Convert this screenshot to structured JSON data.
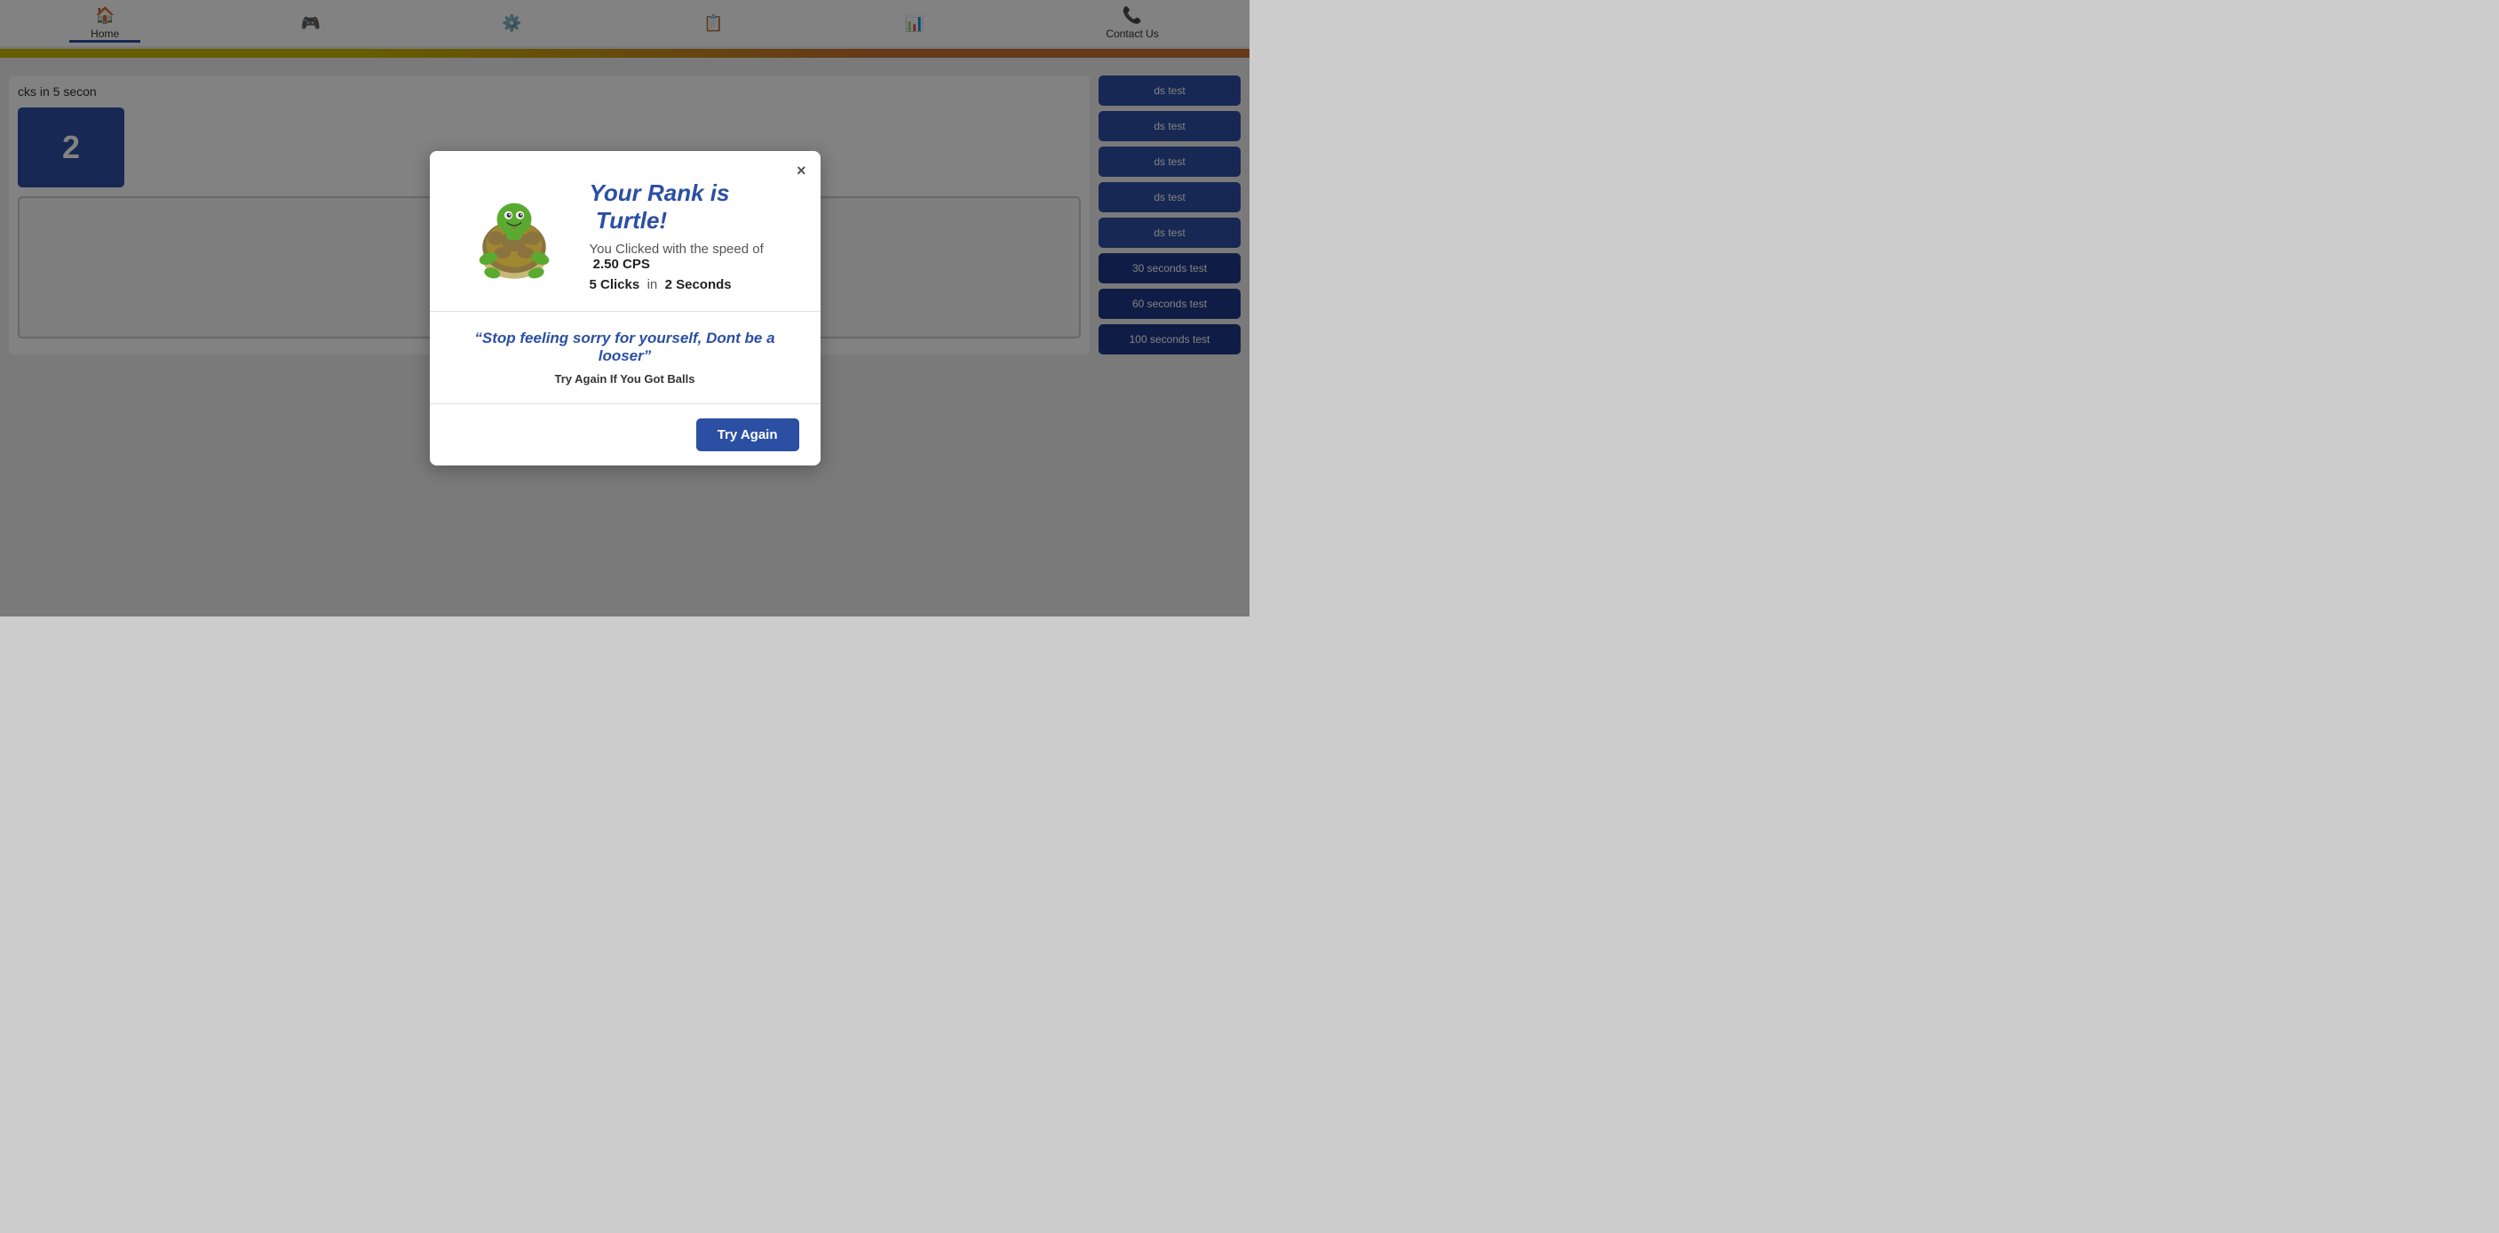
{
  "navbar": {
    "home_label": "Home",
    "contact_label": "Contact Us"
  },
  "background": {
    "truncated_text": "cks in 5 secon",
    "counter": "2",
    "sidebar_buttons": [
      {
        "label": "ds test",
        "style": "normal"
      },
      {
        "label": "ds test",
        "style": "normal"
      },
      {
        "label": "ds test",
        "style": "normal"
      },
      {
        "label": "ds test",
        "style": "normal"
      },
      {
        "label": "ds test",
        "style": "normal"
      },
      {
        "label": "30 seconds test",
        "style": "darker"
      },
      {
        "label": "60 seconds test",
        "style": "darker"
      },
      {
        "label": "100 seconds test",
        "style": "darker"
      }
    ]
  },
  "modal": {
    "close_label": "×",
    "rank_prefix": "Your Rank is",
    "rank_name": "Turtle!",
    "cps_prefix": "You Clicked with the speed of",
    "cps_value": "2.50 CPS",
    "clicks_label": "5 Clicks",
    "in_label": "in",
    "seconds_label": "2 Seconds",
    "quote": "“Stop feeling sorry for yourself, Dont be a looser”",
    "motivation": "Try Again If You Got Balls",
    "try_again_label": "Try Again"
  }
}
